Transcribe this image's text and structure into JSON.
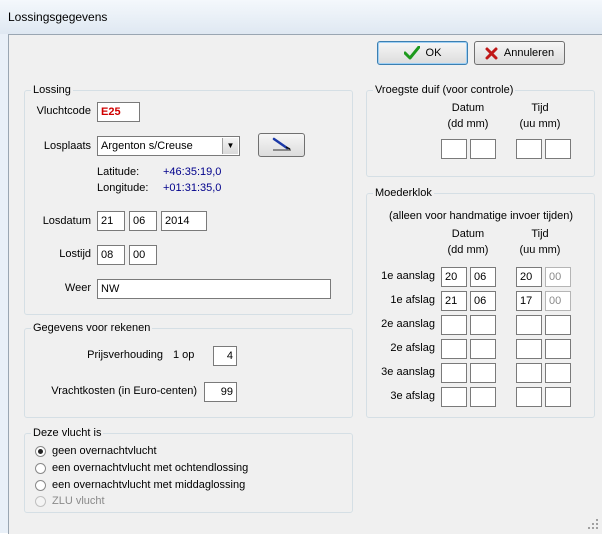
{
  "window": {
    "title": "Lossingsgegevens"
  },
  "buttons": {
    "ok": "OK",
    "cancel": "Annuleren"
  },
  "lossing": {
    "legend": "Lossing",
    "vluchtcode_label": "Vluchtcode",
    "vluchtcode_value": "E25",
    "losplaats_label": "Losplaats",
    "losplaats_value": "Argenton s/Creuse",
    "latitude_label": "Latitude:",
    "latitude_value": "+46:35:19,0",
    "longitude_label": "Longitude:",
    "longitude_value": "+01:31:35,0",
    "losdatum_label": "Losdatum",
    "losdatum_day": "21",
    "losdatum_month": "06",
    "losdatum_year": "2014",
    "lostijd_label": "Lostijd",
    "lostijd_hour": "08",
    "lostijd_min": "00",
    "weer_label": "Weer",
    "weer_value": "NW"
  },
  "rekenen": {
    "legend": "Gegevens voor rekenen",
    "prijs_label": "Prijsverhouding",
    "prijs_op": "1 op",
    "prijs_value": "4",
    "vracht_label": "Vrachtkosten (in Euro-centen)",
    "vracht_value": "99"
  },
  "vlucht": {
    "legend": "Deze vlucht is",
    "options": [
      {
        "label": "geen overnachtvlucht",
        "selected": true,
        "enabled": true
      },
      {
        "label": "een overnachtvlucht met ochtendlossing",
        "selected": false,
        "enabled": true
      },
      {
        "label": "een overnachtvlucht met middaglossing",
        "selected": false,
        "enabled": true
      },
      {
        "label": "ZLU vlucht",
        "selected": false,
        "enabled": false
      }
    ]
  },
  "vroegste": {
    "legend": "Vroegste duif  (voor controle)",
    "datum_label": "Datum",
    "datum_sub": "(dd mm)",
    "tijd_label": "Tijd",
    "tijd_sub": "(uu mm)"
  },
  "moederklok": {
    "legend": "Moederklok",
    "note": "(alleen voor handmatige invoer tijden)",
    "datum_label": "Datum",
    "datum_sub": "(dd mm)",
    "tijd_label": "Tijd",
    "tijd_sub": "(uu mm)",
    "rows": [
      {
        "label": "1e aanslag",
        "dd": "20",
        "mm": "06",
        "uu": "20",
        "min": "00"
      },
      {
        "label": "1e afslag",
        "dd": "21",
        "mm": "06",
        "uu": "17",
        "min": "00"
      },
      {
        "label": "2e aanslag",
        "dd": "",
        "mm": "",
        "uu": "",
        "min": ""
      },
      {
        "label": "2e afslag",
        "dd": "",
        "mm": "",
        "uu": "",
        "min": ""
      },
      {
        "label": "3e aanslag",
        "dd": "",
        "mm": "",
        "uu": "",
        "min": ""
      },
      {
        "label": "3e afslag",
        "dd": "",
        "mm": "",
        "uu": "",
        "min": ""
      }
    ]
  }
}
